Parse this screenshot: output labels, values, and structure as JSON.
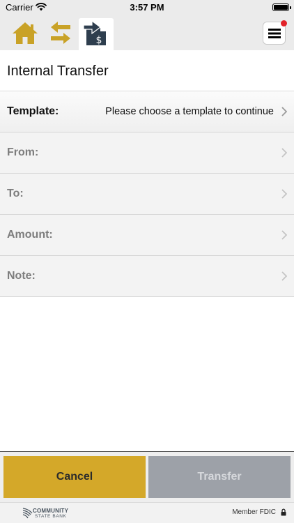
{
  "status_bar": {
    "carrier": "Carrier",
    "time": "3:57 PM",
    "icons": [
      "wifi-icon",
      "battery-icon"
    ]
  },
  "nav": {
    "icons": [
      "home-icon",
      "transfer-arrows-icon",
      "internal-transfer-icon",
      "menu-icon"
    ],
    "accent_color": "#c9a227",
    "active_icon_color": "#2e3e4e",
    "notification_color": "#e2232a"
  },
  "page": {
    "title": "Internal Transfer"
  },
  "form": {
    "template": {
      "label": "Template:",
      "value": "Please choose a template to continue"
    },
    "from": {
      "label": "From:"
    },
    "to": {
      "label": "To:"
    },
    "amount": {
      "label": "Amount:"
    },
    "note": {
      "label": "Note:"
    }
  },
  "actions": {
    "cancel_label": "Cancel",
    "transfer_label": "Transfer",
    "cancel_color": "#d4a829",
    "transfer_color": "#9da1a8"
  },
  "footer": {
    "bank_name_line1": "COMMUNITY",
    "bank_name_line2": "STATE BANK",
    "member_text": "Member FDIC",
    "icons": [
      "bank-logo-icon",
      "lock-icon"
    ]
  }
}
